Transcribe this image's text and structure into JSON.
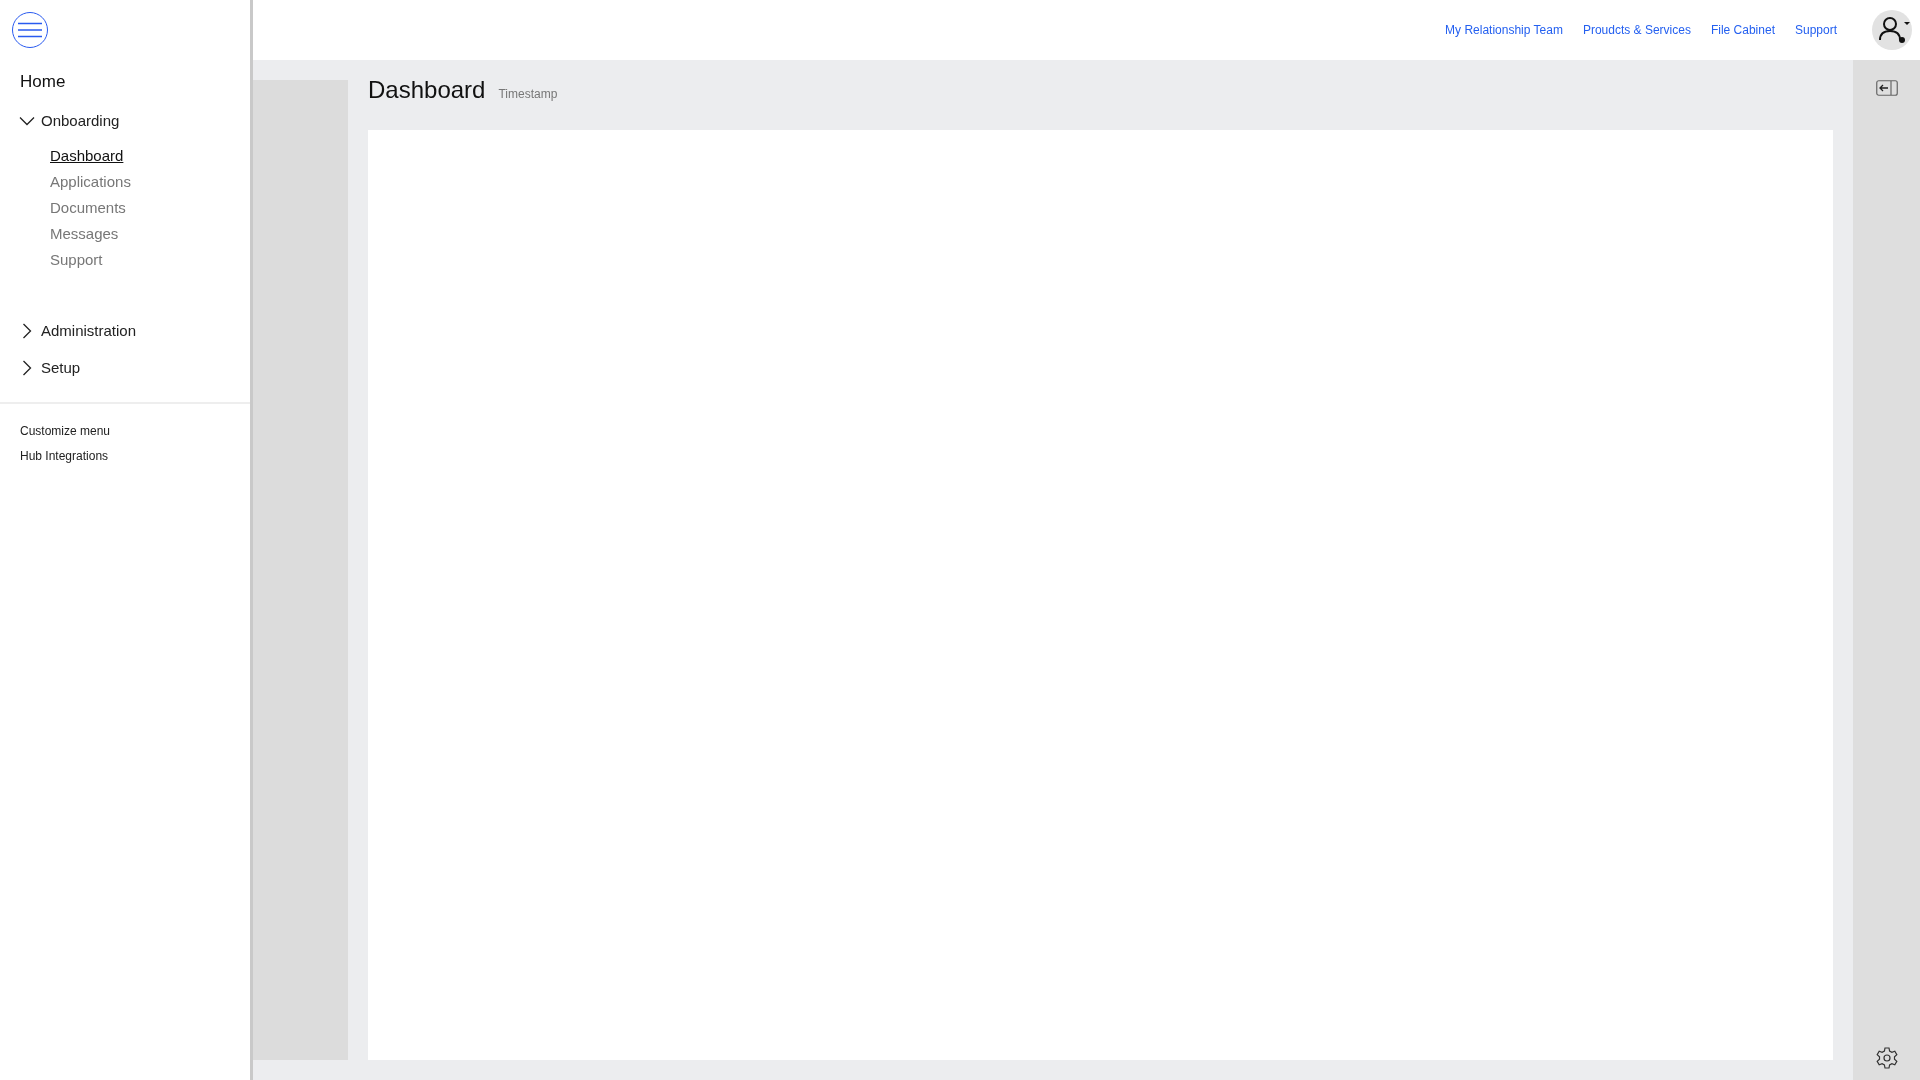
{
  "sidebar": {
    "home": "Home",
    "groups": [
      {
        "label": "Onboarding",
        "expanded": true,
        "children": [
          {
            "label": "Dashboard",
            "selected": true
          },
          {
            "label": "Applications",
            "selected": false
          },
          {
            "label": "Documents",
            "selected": false
          },
          {
            "label": "Messages",
            "selected": false
          },
          {
            "label": "Support",
            "selected": false
          }
        ]
      },
      {
        "label": "Administration",
        "expanded": false
      },
      {
        "label": "Setup",
        "expanded": false
      }
    ],
    "footer_links": [
      "Customize menu",
      "Hub Integrations"
    ]
  },
  "top_nav": [
    "My Relationship Team",
    "Proudcts & Services",
    "File Cabinet",
    "Support"
  ],
  "page": {
    "title": "Dashboard",
    "timestamp": "Timestamp"
  }
}
